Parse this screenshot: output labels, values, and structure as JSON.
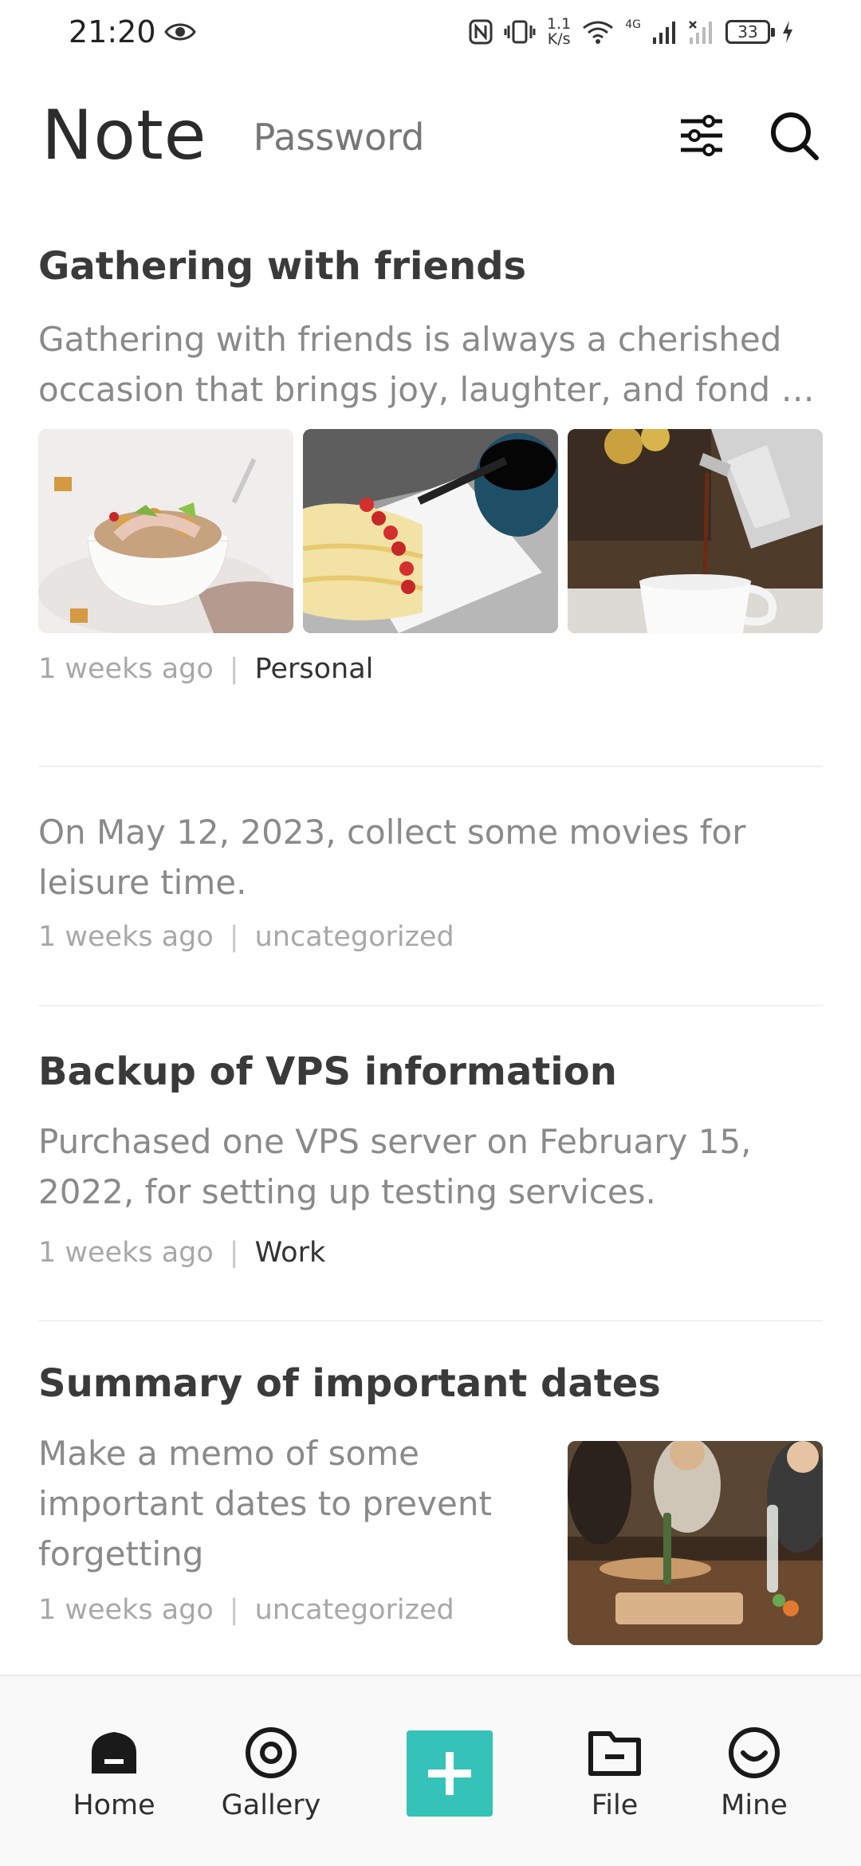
{
  "status_bar": {
    "time": "21:20",
    "net_speed_value": "1.1",
    "net_speed_unit": "K/s",
    "network_label": "4G",
    "battery": "33"
  },
  "header": {
    "title": "Note",
    "tab": "Password"
  },
  "notes": [
    {
      "title": "Gathering with friends",
      "body": "Gathering with friends is always a cherished occasion that brings joy, laughter, and fond …",
      "time": "1 weeks ago",
      "category": "Personal",
      "images": [
        "salad-bowl",
        "cake-with-berries",
        "coffee-pouring"
      ]
    },
    {
      "body": "On May 12, 2023, collect some movies for leisure time.",
      "time": "1 weeks ago",
      "category": "uncategorized"
    },
    {
      "title": "Backup of VPS information",
      "body": "Purchased one VPS server on February 15, 2022, for setting up testing services.",
      "time": "1 weeks ago",
      "category": "Work"
    },
    {
      "title": "Summary of important dates",
      "body": "Make a memo of some important dates to prevent forgetting",
      "time": "1 weeks ago",
      "category": "uncategorized",
      "images": [
        "friends-dinner"
      ]
    }
  ],
  "meta_separator": "|",
  "nav": {
    "home": "Home",
    "gallery": "Gallery",
    "add": "add-icon",
    "file": "File",
    "mine": "Mine"
  },
  "colors": {
    "accent": "#35c2b8",
    "text_primary": "#3a3a3a",
    "text_secondary": "#8a8a8a"
  }
}
